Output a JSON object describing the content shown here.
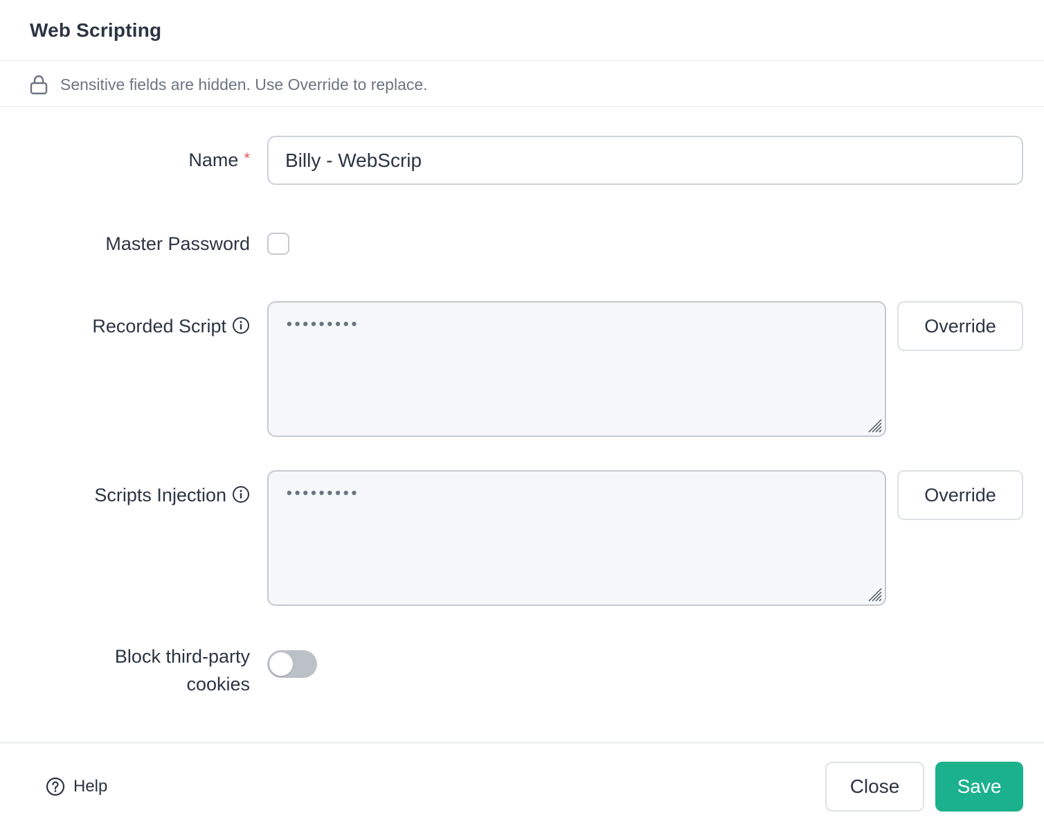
{
  "header": {
    "title": "Web Scripting"
  },
  "notice": {
    "icon": "lock-icon",
    "text": "Sensitive fields are hidden. Use Override to replace."
  },
  "form": {
    "name": {
      "label": "Name",
      "required_mark": "*",
      "value": "Billy - WebScrip"
    },
    "master_password": {
      "label": "Master Password",
      "checked": false
    },
    "recorded_script": {
      "label": "Recorded Script",
      "icon": "info-icon",
      "masked_value": "•••••••••",
      "override_label": "Override"
    },
    "scripts_injection": {
      "label": "Scripts Injection",
      "icon": "info-icon",
      "masked_value": "•••••••••",
      "override_label": "Override"
    },
    "block_cookies": {
      "label_line1": "Block third-party",
      "label_line2": "cookies",
      "enabled": false
    }
  },
  "footer": {
    "help_icon": "question-circle-icon",
    "help_label": "Help",
    "close_label": "Close",
    "save_label": "Save",
    "save_color": "#1bb18c"
  }
}
